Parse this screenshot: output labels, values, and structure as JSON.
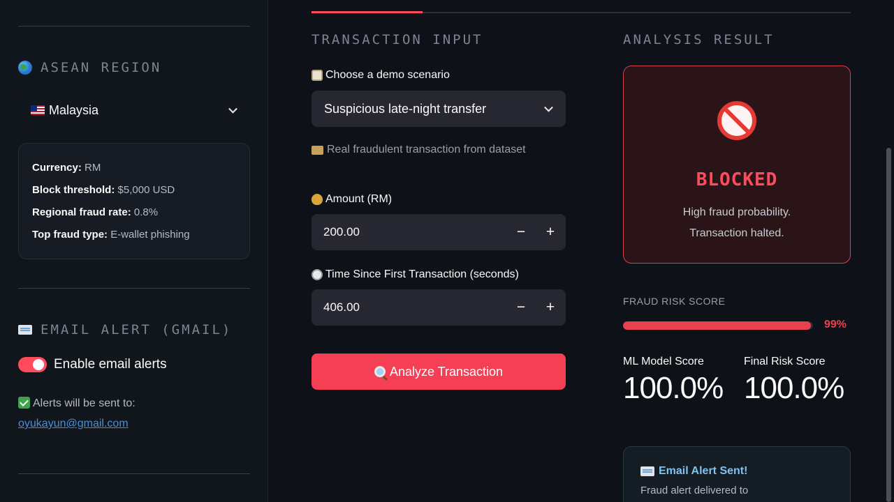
{
  "sidebar": {
    "region_title": "ASEAN REGION",
    "country": "Malaysia",
    "info": [
      {
        "label": "Currency:",
        "value": "RM"
      },
      {
        "label": "Block threshold:",
        "value": "$5,000 USD"
      },
      {
        "label": "Regional fraud rate:",
        "value": "0.8%"
      },
      {
        "label": "Top fraud type:",
        "value": "E-wallet phishing"
      }
    ],
    "email_title": "EMAIL ALERT (GMAIL)",
    "toggle_label": "Enable email alerts",
    "alerts_text": "Alerts will be sent to:",
    "email": "oyukayun@gmail.com"
  },
  "input": {
    "title": "TRANSACTION INPUT",
    "scenario_label": "Choose a demo scenario",
    "scenario_value": "Suspicious late-night transfer",
    "scenario_caption": "Real fraudulent transaction from dataset",
    "amount_label": "Amount (RM)",
    "amount_value": "200.00",
    "time_label": "Time Since First Transaction (seconds)",
    "time_value": "406.00",
    "minus": "−",
    "plus": "+",
    "analyze_label": "Analyze Transaction"
  },
  "result": {
    "title": "ANALYSIS RESULT",
    "status": "BLOCKED",
    "desc_line1": "High fraud probability.",
    "desc_line2": "Transaction halted.",
    "risk_label": "FRAUD RISK SCORE",
    "risk_pct": "99%",
    "risk_fraction": 0.99,
    "ml_label": "ML Model Score",
    "ml_value": "100.0%",
    "final_label": "Final Risk Score",
    "final_value": "100.0%",
    "email_sent_title": "Email Alert Sent!",
    "email_sent_text": "Fraud alert delivered to"
  },
  "colors": {
    "accent": "#ff4b5c",
    "danger": "#e8414f",
    "link": "#4c8fd6"
  }
}
